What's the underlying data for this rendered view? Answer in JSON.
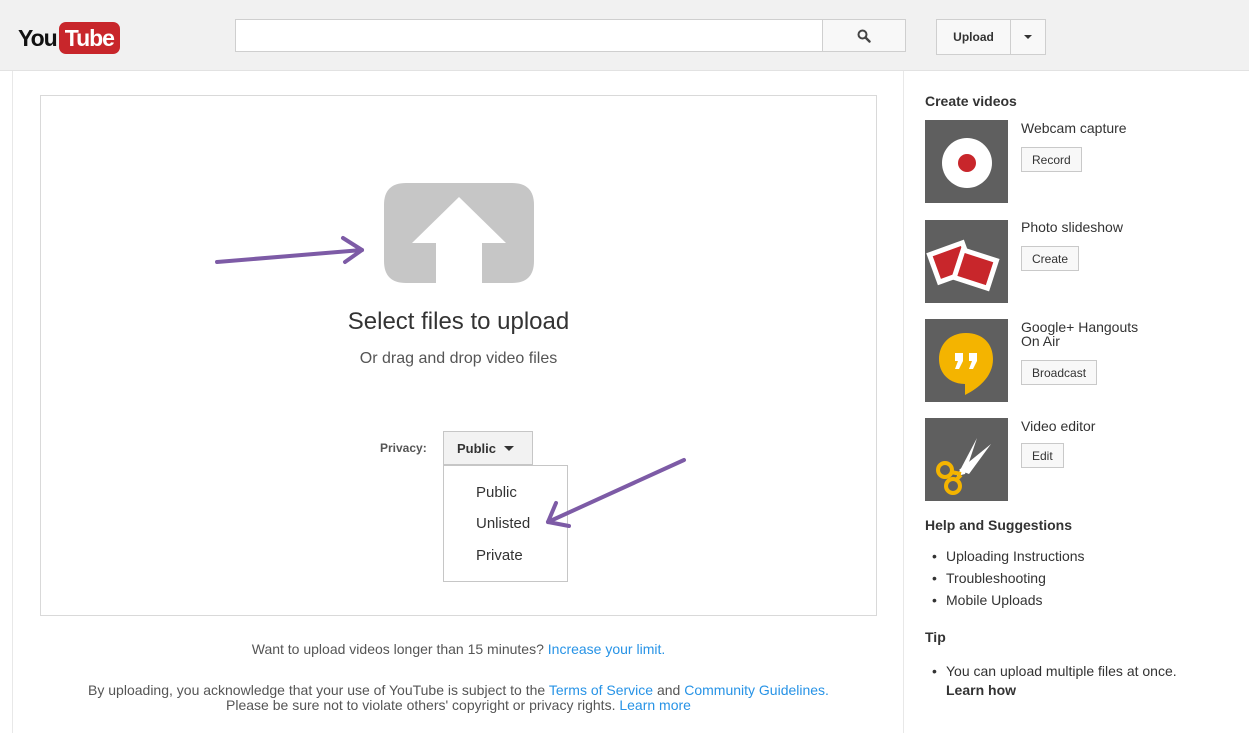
{
  "header": {
    "logo_you": "You",
    "logo_tube": "Tube",
    "search_placeholder": "",
    "upload_label": "Upload"
  },
  "upload": {
    "title": "Select files to upload",
    "subtitle": "Or drag and drop video files",
    "privacy_label": "Privacy:",
    "privacy_selected": "Public",
    "privacy_options": [
      "Public",
      "Unlisted",
      "Private"
    ],
    "long_video_text": "Want to upload videos longer than 15 minutes?",
    "long_video_link": "Increase your limit.",
    "terms_prefix": "By uploading, you acknowledge that your use of YouTube is subject to the",
    "terms_link": "Terms of Service",
    "terms_and": "and",
    "guidelines_link": "Community Guidelines.",
    "terms_line2": "Please be sure not to violate others' copyright or privacy rights.",
    "learn_more_link": "Learn more"
  },
  "sidebar": {
    "create_heading": "Create videos",
    "tools": [
      {
        "name": "Webcam capture",
        "button": "Record"
      },
      {
        "name": "Photo slideshow",
        "button": "Create"
      },
      {
        "name_line1": "Google+ Hangouts",
        "name_line2": "On Air",
        "button": "Broadcast"
      },
      {
        "name": "Video editor",
        "button": "Edit"
      }
    ],
    "help_heading": "Help and Suggestions",
    "help_items": [
      "Uploading Instructions",
      "Troubleshooting",
      "Mobile Uploads"
    ],
    "tip_heading": "Tip",
    "tip_text": "You can upload multiple files at once.",
    "tip_link": "Learn how"
  },
  "colors": {
    "brand_red": "#c8262b",
    "link_blue": "#2793e6",
    "annotation_purple": "#7d5ba6"
  }
}
